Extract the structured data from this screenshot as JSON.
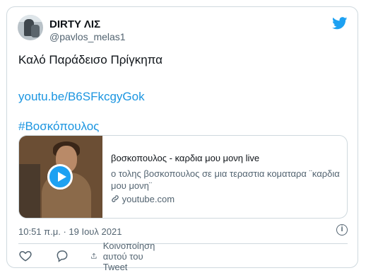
{
  "user": {
    "display_name": "DIRTY ΛΙΣ",
    "handle": "@pavlos_melas1"
  },
  "tweet": {
    "line1": "Καλό Παράδεισο Πρίγκηπα",
    "link": "youtu.be/B6SFkcgyGok",
    "hashtag": "#Βοσκόπουλος"
  },
  "preview": {
    "title": "βοσκοπουλος - καρδια μου μονη live",
    "description": "ο τολης βοσκοπουλος σε μια τεραστια κοματαρα ¨καρδια μου μονη¨",
    "site": "youtube.com"
  },
  "meta": {
    "timestamp": "10:51 π.μ. · 19 Ιουλ 2021",
    "info_glyph": "i"
  },
  "actions": {
    "share_label": "Κοινοποίηση αυτού του Tweet"
  },
  "colors": {
    "link": "#1b95e0",
    "brand": "#1da1f2",
    "secondary_text": "#536471",
    "border": "#cfd9de"
  }
}
